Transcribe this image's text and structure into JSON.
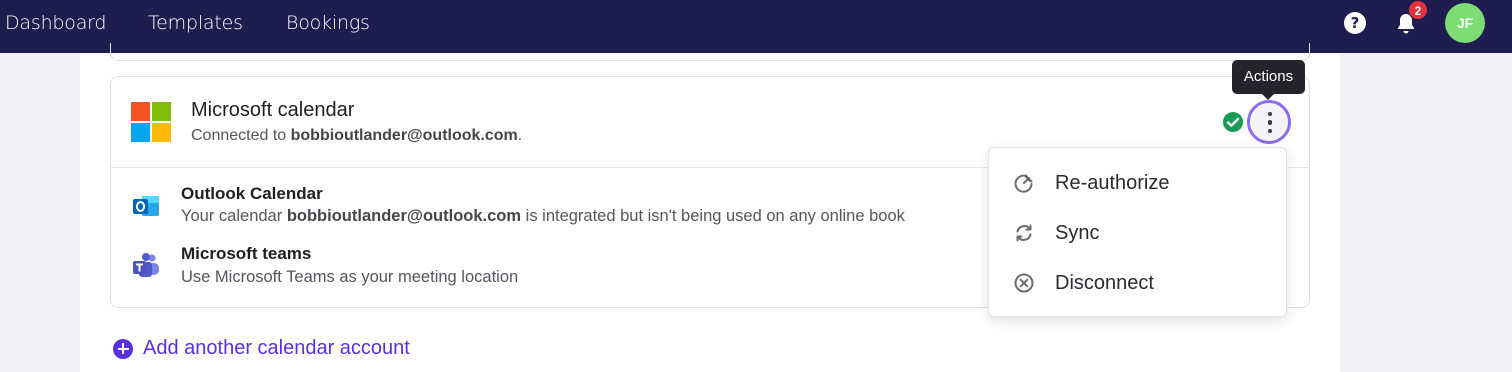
{
  "nav": {
    "items": [
      "Dashboard",
      "Templates",
      "Bookings"
    ],
    "help_icon": "question-circle-icon",
    "bell_icon": "bell-icon",
    "notification_count": "2",
    "avatar_initials": "JF"
  },
  "colors": {
    "topbar": "#1f1c4f",
    "accent": "#5a2fe0",
    "success": "#1a9b55",
    "badge": "#e5323f",
    "avatar": "#7ddc74"
  },
  "card": {
    "title": "Microsoft calendar",
    "subtitle_prefix": "Connected to ",
    "email": "bobbioutlander@outlook.com",
    "subtitle_suffix": ".",
    "status_icon": "check-circle-icon",
    "actions_icon": "more-vertical-icon",
    "rows": [
      {
        "icon": "outlook-icon",
        "title": "Outlook Calendar",
        "desc_prefix": "Your calendar ",
        "desc_email": "bobbioutlander@outlook.com",
        "desc_suffix": " is integrated but isn't being used on any online book"
      },
      {
        "icon": "teams-icon",
        "title": "Microsoft teams",
        "desc": "Use Microsoft Teams as your meeting location"
      }
    ]
  },
  "tooltip": "Actions",
  "menu": {
    "items": [
      {
        "label": "Re-authorize",
        "icon": "plug-icon"
      },
      {
        "label": "Sync",
        "icon": "sync-icon"
      },
      {
        "label": "Disconnect",
        "icon": "x-circle-icon"
      }
    ]
  },
  "add_account": {
    "label": "Add another calendar account",
    "icon": "plus-circle-icon"
  }
}
